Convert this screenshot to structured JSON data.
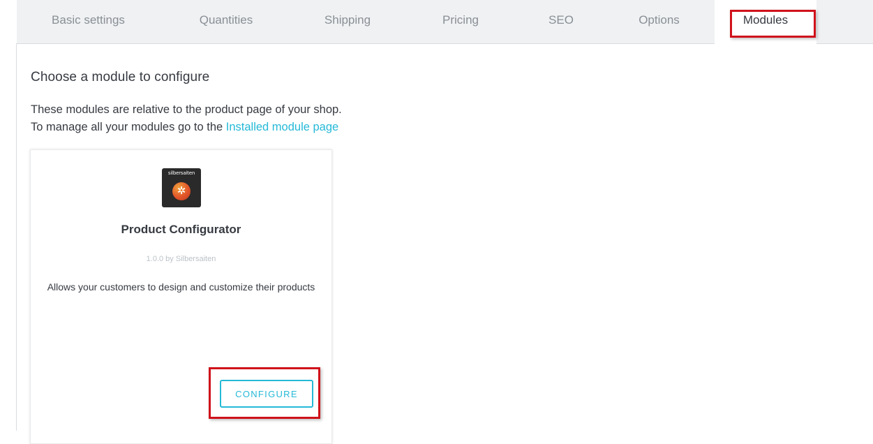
{
  "tabs": [
    {
      "label": "Basic settings"
    },
    {
      "label": "Quantities"
    },
    {
      "label": "Shipping"
    },
    {
      "label": "Pricing"
    },
    {
      "label": "SEO"
    },
    {
      "label": "Options"
    },
    {
      "label": "Modules",
      "active": true
    }
  ],
  "section": {
    "title": "Choose a module to configure",
    "description_line1": "These modules are relative to the product page of your shop.",
    "description_line2_prefix": "To manage all your modules go to the ",
    "description_link": "Installed module page"
  },
  "module_card": {
    "logo_text": "silbersaiten",
    "logo_icon": "gear-icon",
    "name": "Product Configurator",
    "version_author": "1.0.0 by Silbersaiten",
    "description": "Allows your customers to design and customize their products",
    "configure_label": "CONFIGURE"
  },
  "colors": {
    "accent": "#25b9d7",
    "highlight": "#d0121b",
    "tab_bar_bg": "#eff1f2",
    "text": "#363a41"
  }
}
